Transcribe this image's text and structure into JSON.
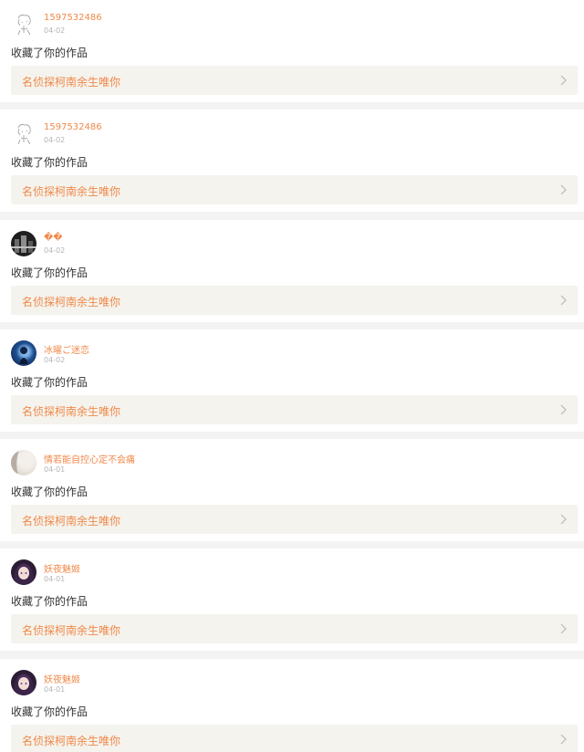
{
  "feed": {
    "notifications": [
      {
        "username": "1597532486",
        "date": "04-02",
        "avatar": "sketch-character-avatar",
        "action": "收藏了你的作品",
        "work_title": "名侦探柯南余生唯你"
      },
      {
        "username": "1597532486",
        "date": "04-02",
        "avatar": "sketch-character-avatar",
        "action": "收藏了你的作品",
        "work_title": "名侦探柯南余生唯你"
      },
      {
        "username": "��",
        "date": "04-02",
        "avatar": "dark-city-avatar",
        "action": "收藏了你的作品",
        "work_title": "名侦探柯南余生唯你"
      },
      {
        "username": "冰曜ご迷恋",
        "date": "04-02",
        "avatar": "blue-anime-avatar",
        "action": "收藏了你的作品",
        "work_title": "名侦探柯南余生唯你"
      },
      {
        "username": "情若能自控心定不会痛",
        "date": "04-01",
        "avatar": "pale-face-avatar",
        "action": "收藏了你的作品",
        "work_title": "名侦探柯南余生唯你"
      },
      {
        "username": "妖夜魅姬",
        "date": "04-01",
        "avatar": "dark-anime-girl-avatar",
        "action": "收藏了你的作品",
        "work_title": "名侦探柯南余生唯你"
      },
      {
        "username": "妖夜魅姬",
        "date": "04-01",
        "avatar": "dark-anime-girl-avatar",
        "action": "收藏了你的作品",
        "work_title": "名侦探柯南余生唯你"
      }
    ]
  },
  "colors": {
    "accent": "#f0894a",
    "page_background": "#f3f3f3",
    "card_background": "#ffffff",
    "work_link_background": "#f5f3ed",
    "date_text": "#b5b5b5",
    "body_text": "#333333"
  }
}
